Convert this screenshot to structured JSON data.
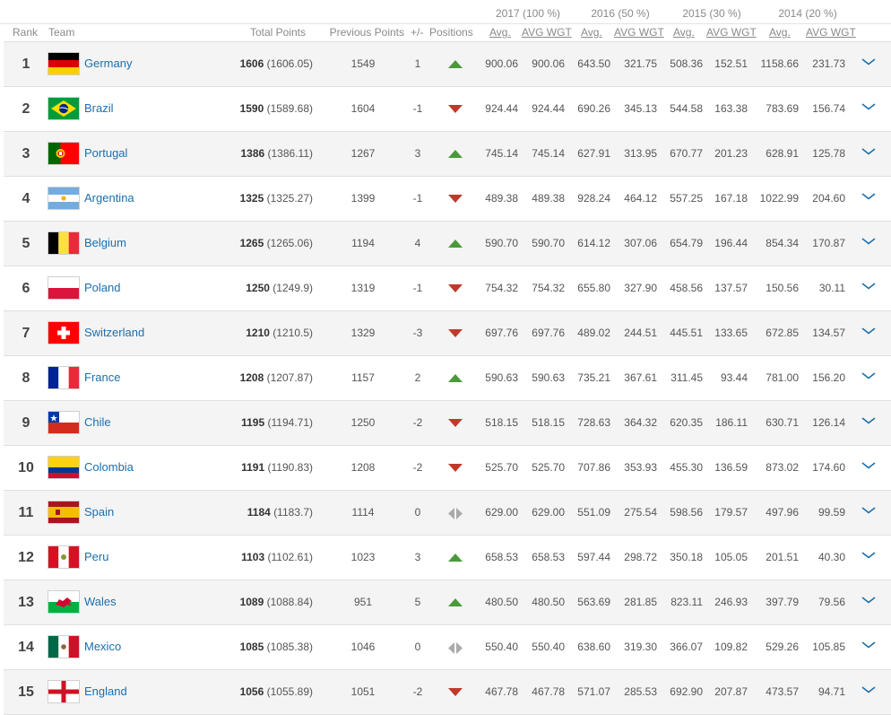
{
  "header": {
    "years": [
      {
        "label": "2017 (100 %)"
      },
      {
        "label": "2016 (50 %)"
      },
      {
        "label": "2015 (30 %)"
      },
      {
        "label": "2014 (20 %)"
      }
    ],
    "columns": {
      "rank": "Rank",
      "team": "Team",
      "total_points": "Total Points",
      "previous_points": "Previous Points",
      "change": "+/-",
      "positions": "Positions",
      "avg": "Avg.",
      "avg_wgt": "AVG WGT"
    }
  },
  "colors": {
    "link": "#1b6fae",
    "up": "#4a9a3b",
    "down": "#c0392b",
    "same": "#aaaaaa",
    "row_alt": "#f4f4f4"
  },
  "rows": [
    {
      "rank": "1",
      "team": "Germany",
      "flag": "germany",
      "total": "1606",
      "total_exact": "(1606.05)",
      "prev": "1549",
      "change": "1",
      "trend": "up",
      "y2017_avg": "900.06",
      "y2017_wgt": "900.06",
      "y2016_avg": "643.50",
      "y2016_wgt": "321.75",
      "y2015_avg": "508.36",
      "y2015_wgt": "152.51",
      "y2014_avg": "1158.66",
      "y2014_wgt": "231.73"
    },
    {
      "rank": "2",
      "team": "Brazil",
      "flag": "brazil",
      "total": "1590",
      "total_exact": "(1589.68)",
      "prev": "1604",
      "change": "-1",
      "trend": "down",
      "y2017_avg": "924.44",
      "y2017_wgt": "924.44",
      "y2016_avg": "690.26",
      "y2016_wgt": "345.13",
      "y2015_avg": "544.58",
      "y2015_wgt": "163.38",
      "y2014_avg": "783.69",
      "y2014_wgt": "156.74"
    },
    {
      "rank": "3",
      "team": "Portugal",
      "flag": "portugal",
      "total": "1386",
      "total_exact": "(1386.11)",
      "prev": "1267",
      "change": "3",
      "trend": "up",
      "y2017_avg": "745.14",
      "y2017_wgt": "745.14",
      "y2016_avg": "627.91",
      "y2016_wgt": "313.95",
      "y2015_avg": "670.77",
      "y2015_wgt": "201.23",
      "y2014_avg": "628.91",
      "y2014_wgt": "125.78"
    },
    {
      "rank": "4",
      "team": "Argentina",
      "flag": "argentina",
      "total": "1325",
      "total_exact": "(1325.27)",
      "prev": "1399",
      "change": "-1",
      "trend": "down",
      "y2017_avg": "489.38",
      "y2017_wgt": "489.38",
      "y2016_avg": "928.24",
      "y2016_wgt": "464.12",
      "y2015_avg": "557.25",
      "y2015_wgt": "167.18",
      "y2014_avg": "1022.99",
      "y2014_wgt": "204.60"
    },
    {
      "rank": "5",
      "team": "Belgium",
      "flag": "belgium",
      "total": "1265",
      "total_exact": "(1265.06)",
      "prev": "1194",
      "change": "4",
      "trend": "up",
      "y2017_avg": "590.70",
      "y2017_wgt": "590.70",
      "y2016_avg": "614.12",
      "y2016_wgt": "307.06",
      "y2015_avg": "654.79",
      "y2015_wgt": "196.44",
      "y2014_avg": "854.34",
      "y2014_wgt": "170.87"
    },
    {
      "rank": "6",
      "team": "Poland",
      "flag": "poland",
      "total": "1250",
      "total_exact": "(1249.9)",
      "prev": "1319",
      "change": "-1",
      "trend": "down",
      "y2017_avg": "754.32",
      "y2017_wgt": "754.32",
      "y2016_avg": "655.80",
      "y2016_wgt": "327.90",
      "y2015_avg": "458.56",
      "y2015_wgt": "137.57",
      "y2014_avg": "150.56",
      "y2014_wgt": "30.11"
    },
    {
      "rank": "7",
      "team": "Switzerland",
      "flag": "switzerland",
      "total": "1210",
      "total_exact": "(1210.5)",
      "prev": "1329",
      "change": "-3",
      "trend": "down",
      "y2017_avg": "697.76",
      "y2017_wgt": "697.76",
      "y2016_avg": "489.02",
      "y2016_wgt": "244.51",
      "y2015_avg": "445.51",
      "y2015_wgt": "133.65",
      "y2014_avg": "672.85",
      "y2014_wgt": "134.57"
    },
    {
      "rank": "8",
      "team": "France",
      "flag": "france",
      "total": "1208",
      "total_exact": "(1207.87)",
      "prev": "1157",
      "change": "2",
      "trend": "up",
      "y2017_avg": "590.63",
      "y2017_wgt": "590.63",
      "y2016_avg": "735.21",
      "y2016_wgt": "367.61",
      "y2015_avg": "311.45",
      "y2015_wgt": "93.44",
      "y2014_avg": "781.00",
      "y2014_wgt": "156.20"
    },
    {
      "rank": "9",
      "team": "Chile",
      "flag": "chile",
      "total": "1195",
      "total_exact": "(1194.71)",
      "prev": "1250",
      "change": "-2",
      "trend": "down",
      "y2017_avg": "518.15",
      "y2017_wgt": "518.15",
      "y2016_avg": "728.63",
      "y2016_wgt": "364.32",
      "y2015_avg": "620.35",
      "y2015_wgt": "186.11",
      "y2014_avg": "630.71",
      "y2014_wgt": "126.14"
    },
    {
      "rank": "10",
      "team": "Colombia",
      "flag": "colombia",
      "total": "1191",
      "total_exact": "(1190.83)",
      "prev": "1208",
      "change": "-2",
      "trend": "down",
      "y2017_avg": "525.70",
      "y2017_wgt": "525.70",
      "y2016_avg": "707.86",
      "y2016_wgt": "353.93",
      "y2015_avg": "455.30",
      "y2015_wgt": "136.59",
      "y2014_avg": "873.02",
      "y2014_wgt": "174.60"
    },
    {
      "rank": "11",
      "team": "Spain",
      "flag": "spain",
      "total": "1184",
      "total_exact": "(1183.7)",
      "prev": "1114",
      "change": "0",
      "trend": "same",
      "y2017_avg": "629.00",
      "y2017_wgt": "629.00",
      "y2016_avg": "551.09",
      "y2016_wgt": "275.54",
      "y2015_avg": "598.56",
      "y2015_wgt": "179.57",
      "y2014_avg": "497.96",
      "y2014_wgt": "99.59"
    },
    {
      "rank": "12",
      "team": "Peru",
      "flag": "peru",
      "total": "1103",
      "total_exact": "(1102.61)",
      "prev": "1023",
      "change": "3",
      "trend": "up",
      "y2017_avg": "658.53",
      "y2017_wgt": "658.53",
      "y2016_avg": "597.44",
      "y2016_wgt": "298.72",
      "y2015_avg": "350.18",
      "y2015_wgt": "105.05",
      "y2014_avg": "201.51",
      "y2014_wgt": "40.30"
    },
    {
      "rank": "13",
      "team": "Wales",
      "flag": "wales",
      "total": "1089",
      "total_exact": "(1088.84)",
      "prev": "951",
      "change": "5",
      "trend": "up",
      "y2017_avg": "480.50",
      "y2017_wgt": "480.50",
      "y2016_avg": "563.69",
      "y2016_wgt": "281.85",
      "y2015_avg": "823.11",
      "y2015_wgt": "246.93",
      "y2014_avg": "397.79",
      "y2014_wgt": "79.56"
    },
    {
      "rank": "14",
      "team": "Mexico",
      "flag": "mexico",
      "total": "1085",
      "total_exact": "(1085.38)",
      "prev": "1046",
      "change": "0",
      "trend": "same",
      "y2017_avg": "550.40",
      "y2017_wgt": "550.40",
      "y2016_avg": "638.60",
      "y2016_wgt": "319.30",
      "y2015_avg": "366.07",
      "y2015_wgt": "109.82",
      "y2014_avg": "529.26",
      "y2014_wgt": "105.85"
    },
    {
      "rank": "15",
      "team": "England",
      "flag": "england",
      "total": "1056",
      "total_exact": "(1055.89)",
      "prev": "1051",
      "change": "-2",
      "trend": "down",
      "y2017_avg": "467.78",
      "y2017_wgt": "467.78",
      "y2016_avg": "571.07",
      "y2016_wgt": "285.53",
      "y2015_avg": "692.90",
      "y2015_wgt": "207.87",
      "y2014_avg": "473.57",
      "y2014_wgt": "94.71"
    }
  ]
}
